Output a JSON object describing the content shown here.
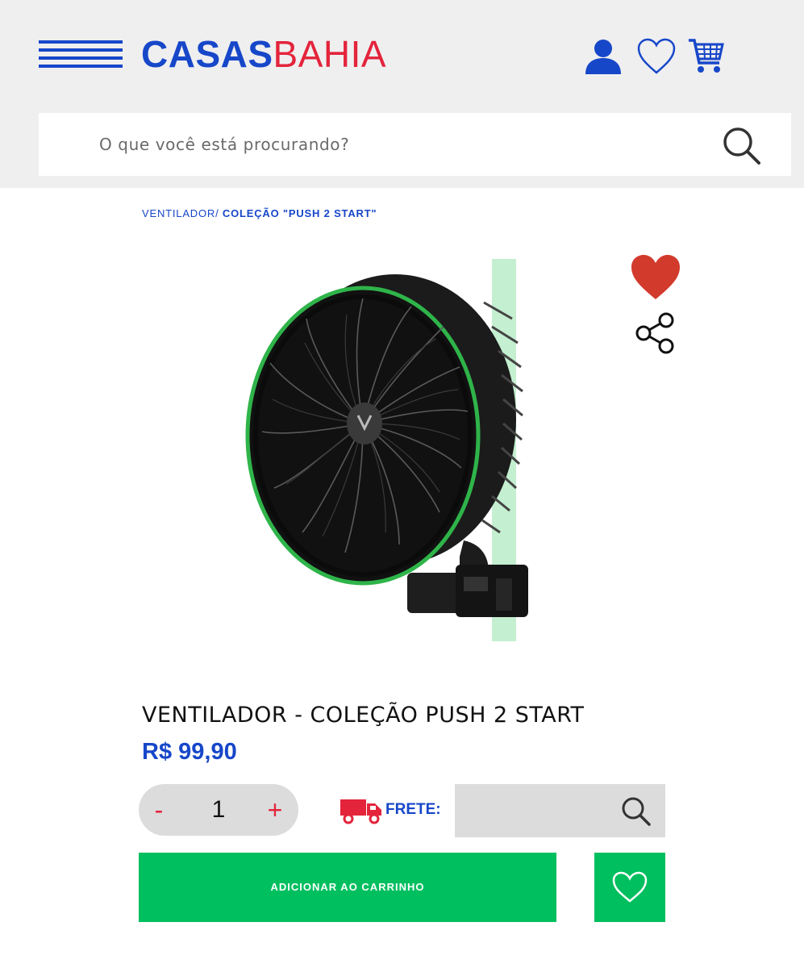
{
  "header": {
    "logo_part1": "CASAS",
    "logo_part2": "BAHIA",
    "icons": [
      "menu-icon",
      "user-icon",
      "heart-icon",
      "cart-icon"
    ]
  },
  "search": {
    "placeholder": "O que você está procurando?"
  },
  "breadcrumb": {
    "item1": "VENTILADOR",
    "separator": "/",
    "item2": "COLEÇÃO \"PUSH 2 START\""
  },
  "product": {
    "title": "VENTILADOR - COLEÇÃO PUSH 2 START",
    "price": "R$ 99,90",
    "quantity": "1",
    "minus_label": "-",
    "plus_label": "+"
  },
  "shipping": {
    "label": "FRETE:"
  },
  "actions": {
    "add_to_cart": "ADICIONAR AO CARRINHO"
  },
  "colors": {
    "brand_blue": "#1747c9",
    "brand_red": "#e3243b",
    "cta_green": "#00bf5f",
    "heart_red": "#d23a2c"
  }
}
